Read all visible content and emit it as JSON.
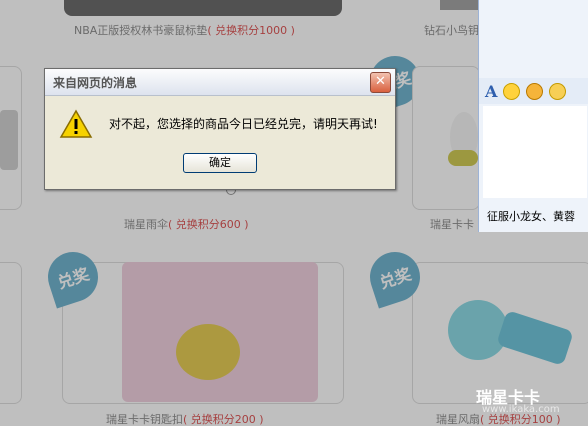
{
  "captions": {
    "top_left": {
      "name": "NBA正版授权林书豪鼠标垫",
      "points": "( 兑换积分1000 )"
    },
    "top_right": {
      "name": "钻石小鸟钥"
    },
    "mid_left": {
      "name": "瑞星雨伞",
      "points": "( 兑换积分600 )"
    },
    "mid_right": {
      "name": "瑞星卡卡"
    },
    "bottom_left": {
      "name": "瑞星卡卡钥匙扣",
      "points": "( 兑换积分200 )"
    },
    "bottom_right": {
      "name": "瑞星风扇",
      "points": "( 兑换积分100 )"
    }
  },
  "badge_label": "兑奖",
  "chat_panel": {
    "toolbar_icons": [
      "font-icon",
      "smiley-icon",
      "angry-face-icon",
      "emoji-face-icon"
    ],
    "font_glyph": "A",
    "names_text": "征服小龙女、黄蓉"
  },
  "dialog": {
    "title": "来自网页的消息",
    "close_glyph": "✕",
    "message": "对不起，您选择的商品今日已经兑完，请明天再试!",
    "ok_label": "确定",
    "icon": "warning-icon"
  },
  "watermark": {
    "logo": "瑞星卡卡",
    "url": "www.ikaka.com"
  }
}
